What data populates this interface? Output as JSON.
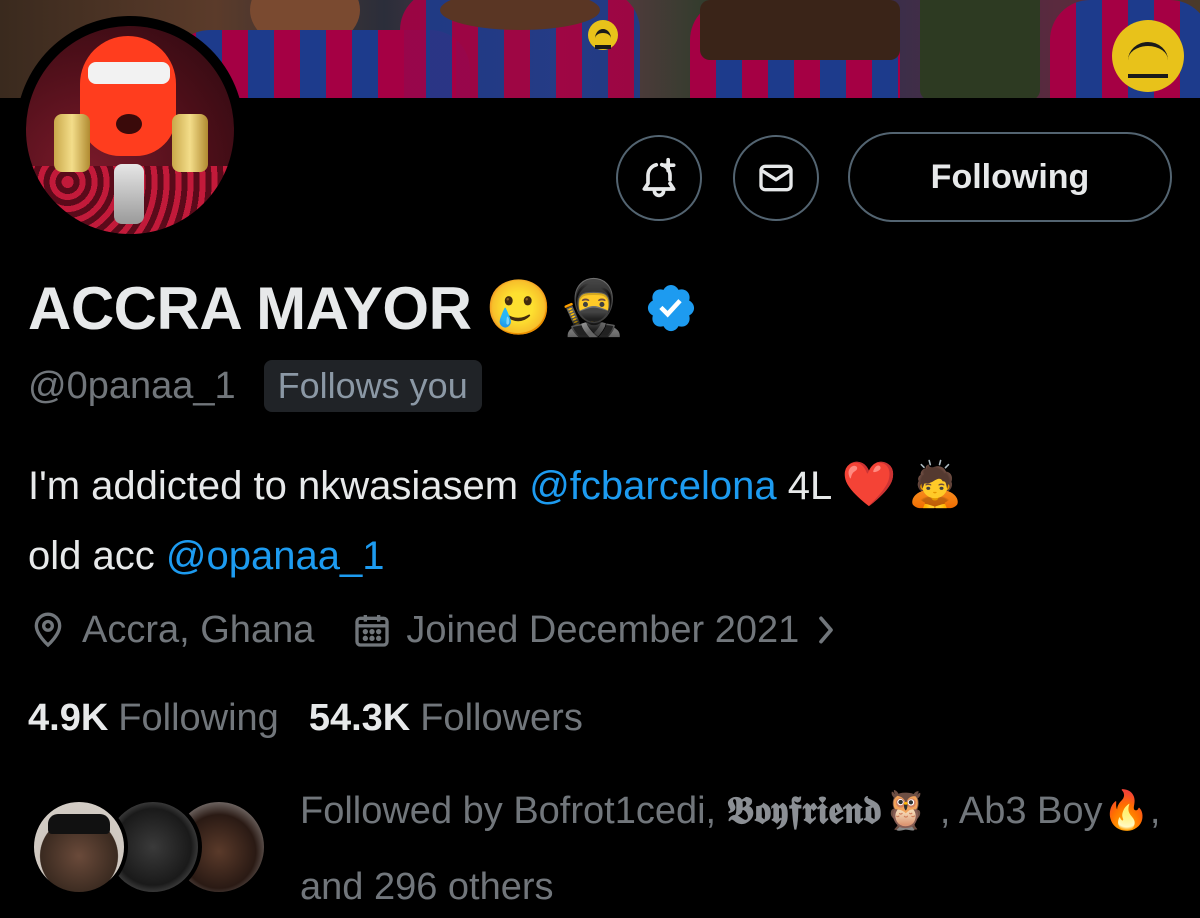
{
  "profile": {
    "display_name": "ACCRA MAYOR",
    "name_emojis": [
      "🥲",
      "🥷"
    ],
    "verified": true,
    "handle": "@0panaa_1",
    "follows_you_badge": "Follows you",
    "bio": {
      "text_1": "I'm addicted to nkwasiasem ",
      "mention_1": "@fcbarcelona",
      "text_2": " 4L ",
      "emoji_1": "❤️",
      "emoji_2": "🙇",
      "text_3": "old acc ",
      "mention_2": "@opanaa_1"
    },
    "location": "Accra, Ghana",
    "joined": "Joined December 2021",
    "following_count": "4.9K",
    "following_label": "Following",
    "followers_count": "54.3K",
    "followers_label": "Followers",
    "followed_by": {
      "prefix": "Followed by Bofrot1cedi, ",
      "name_2": "𝕭𝖔𝖞𝖋𝖗𝖎𝖊𝖓𝖉",
      "owl": "🦉",
      "middle": " , Ab3 Boy",
      "fire": "🔥",
      "suffix": ", and 296 others"
    }
  },
  "actions": {
    "notify_icon": "bell-plus-icon",
    "message_icon": "envelope-icon",
    "follow_state": "Following"
  },
  "icons": {
    "location": "map-pin-icon",
    "calendar": "calendar-icon",
    "chevron": "chevron-right-icon",
    "verified": "verified-badge-icon"
  },
  "colors": {
    "background": "#000000",
    "text_primary": "#e7e9ea",
    "text_secondary": "#71767b",
    "link": "#1d9bf0",
    "border": "#536471",
    "verified": "#1d9bf0"
  }
}
